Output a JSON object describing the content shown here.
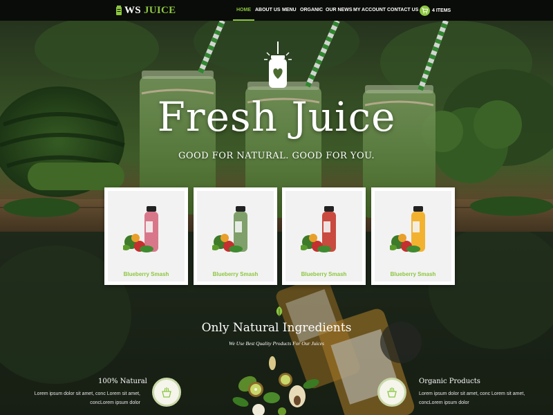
{
  "brand": {
    "prefix": "WS",
    "name": "JUICE",
    "accent": "#8cc63f"
  },
  "nav": {
    "items": [
      {
        "label": "HOME",
        "active": true
      },
      {
        "label": "ABOUT US",
        "active": false
      },
      {
        "label": "MENU",
        "active": false
      },
      {
        "label": "ORGANIC",
        "active": false
      },
      {
        "label": "OUR NEWS",
        "active": false
      },
      {
        "label": "MY ACCOUNT",
        "active": false
      },
      {
        "label": "CONTACT US",
        "active": false
      }
    ],
    "cart": {
      "icon": "cart-icon",
      "label": "4 ITEMS"
    }
  },
  "hero": {
    "icon": "juice-jar-heart-icon",
    "title": "Fresh Juice",
    "subtitle": "GOOD FOR NATURAL. GOOD FOR YOU."
  },
  "products": [
    {
      "name": "Blueberry Smash",
      "juice_color": "#d9778a"
    },
    {
      "name": "Blueberry Smash",
      "juice_color": "#7fa06a"
    },
    {
      "name": "Blueberry Smash",
      "juice_color": "#c94a3e"
    },
    {
      "name": "Blueberry Smash",
      "juice_color": "#f2b230"
    }
  ],
  "ingredients": {
    "icon": "leaf-icon",
    "title": "Only Natural Ingredients",
    "subtitle": "We Use Best Quality Products For Our Juices",
    "features": [
      {
        "title": "100% Natural",
        "text_line1": "Lorem ipsum dolor sit amet, conc Lorem sit amet,",
        "text_line2": "concLorem ipsum dolor",
        "icon": "basket-icon"
      },
      {
        "title": "Organic Products",
        "text_line1": "Lorem ipsum dolor sit amet, conc Lorem sit amet,",
        "text_line2": "concLorem ipsum dolor",
        "icon": "basket-icon"
      }
    ]
  }
}
